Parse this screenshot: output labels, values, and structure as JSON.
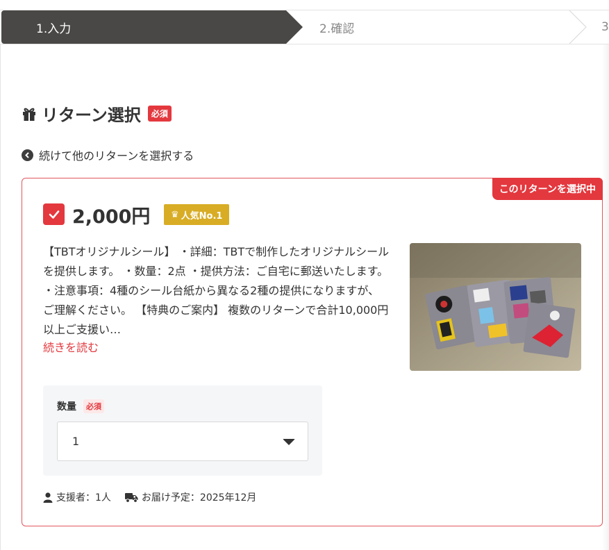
{
  "stepper": {
    "steps": [
      {
        "label": "1.入力"
      },
      {
        "label": "2.確認"
      },
      {
        "label": "3"
      }
    ]
  },
  "section": {
    "title": "リターン選択",
    "required_badge": "必須"
  },
  "back_link": "続けて他のリターンを選択する",
  "reward": {
    "selected_tab": "このリターンを選択中",
    "price": "2,000円",
    "rank_badge": "人気No.1",
    "description": "【TBTオリジナルシール】 ・詳細：TBTで制作したオリジナルシールを提供します。 ・数量：2点 ・提供方法：ご自宅に郵送いたします。 ・注意事項：4種のシール台紙から異なる2種の提供になりますが、ご理解ください。 【特典のご案内】 複数のリターンで合計10,000円以上ご支援い…",
    "read_more": "続きを読む",
    "quantity": {
      "label": "数量",
      "required": "必須",
      "value": "1"
    },
    "supporters": "支援者：1人",
    "delivery": "お届け予定：2025年12月"
  },
  "colors": {
    "accent": "#e3383e",
    "step_active": "#4a4846",
    "rank_gold": "#d8ad25"
  }
}
